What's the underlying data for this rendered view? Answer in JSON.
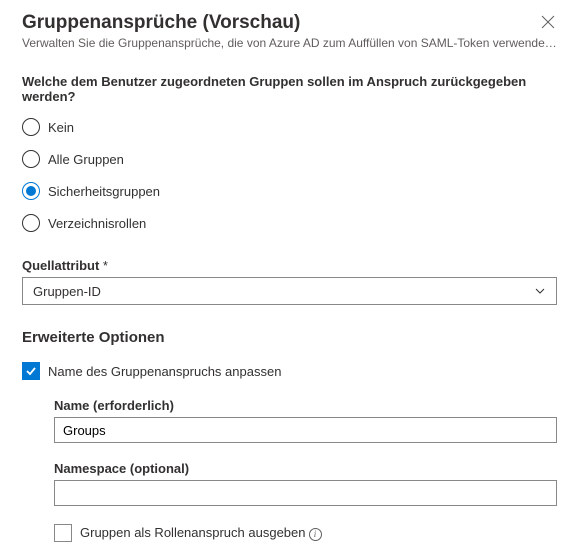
{
  "header": {
    "title": "Gruppenansprüche (Vorschau)",
    "subtitle": "Verwalten Sie die Gruppenansprüche, die von Azure AD zum Auffüllen von SAML-Token verwendet werden, die für Ihr..."
  },
  "question": "Welche dem Benutzer zugeordneten Gruppen sollen im Anspruch zurückgegeben werden?",
  "radio_options": {
    "none": "Kein",
    "all": "Alle Gruppen",
    "security": "Sicherheitsgruppen",
    "directory": "Verzeichnisrollen"
  },
  "source_attribute": {
    "label": "Quellattribut",
    "required_marker": "*",
    "value": "Gruppen-ID"
  },
  "advanced": {
    "heading": "Erweiterte Optionen",
    "customize_name_label": "Name des Gruppenanspruchs anpassen",
    "name_field": {
      "label": "Name (erforderlich)",
      "value": "Groups"
    },
    "namespace_field": {
      "label": "Namespace (optional)",
      "value": ""
    },
    "emit_roles_label": "Gruppen als Rollenanspruch ausgeben"
  }
}
